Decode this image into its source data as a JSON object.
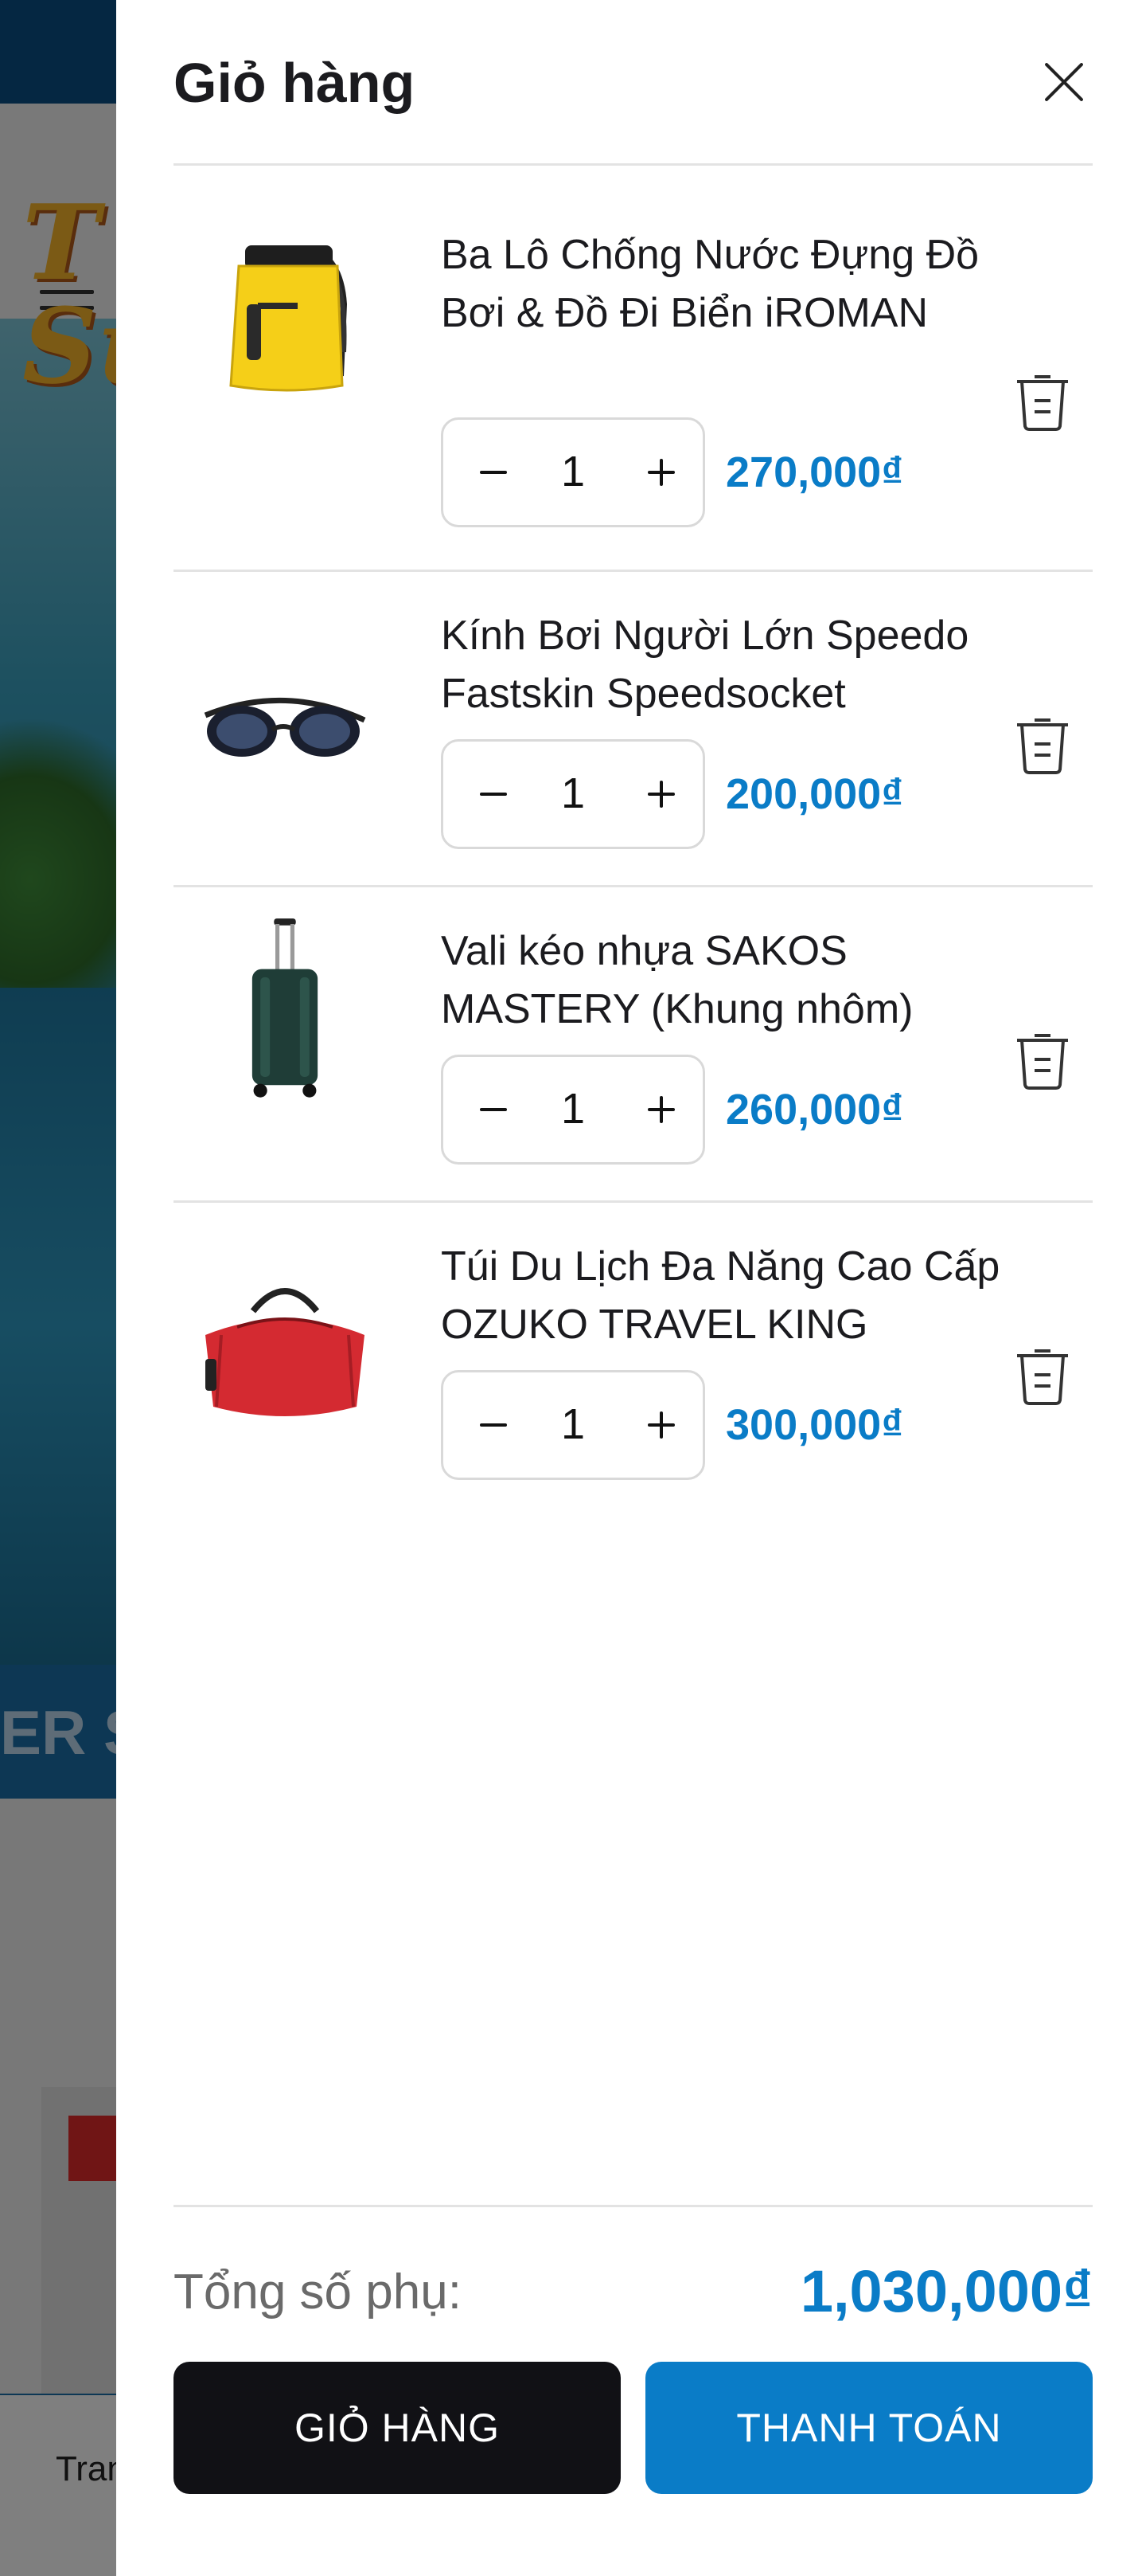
{
  "background": {
    "banner_text": "T\nSu",
    "strip_text": "ER S",
    "nav_text": "Tran"
  },
  "cart": {
    "title": "Giỏ hàng",
    "close_icon": "close-icon",
    "items": [
      {
        "name": "Ba Lô Chống Nước Đựng Đồ Bơi & Đồ Đi Biển iROMAN",
        "quantity": "1",
        "price": "270,000₫",
        "image": "yellow-waterproof-backpack"
      },
      {
        "name": "Kính Bơi Người Lớn Speedo Fastskin Speedsocket",
        "quantity": "1",
        "price": "200,000₫",
        "image": "swimming-goggles"
      },
      {
        "name": "Vali kéo nhựa SAKOS MASTERY (Khung nhôm)",
        "quantity": "1",
        "price": "260,000₫",
        "image": "green-rolling-suitcase"
      },
      {
        "name": "Túi Du Lịch Đa Năng Cao Cấp OZUKO TRAVEL KING",
        "quantity": "1",
        "price": "300,000₫",
        "image": "red-duffel-bag"
      }
    ],
    "subtotal_label": "Tổng số phụ:",
    "subtotal_value": "1,030,000₫",
    "view_cart_label": "GIỎ HÀNG",
    "checkout_label": "THANH TOÁN",
    "colors": {
      "accent": "#0a7cc7",
      "dark_button": "#111115"
    }
  }
}
